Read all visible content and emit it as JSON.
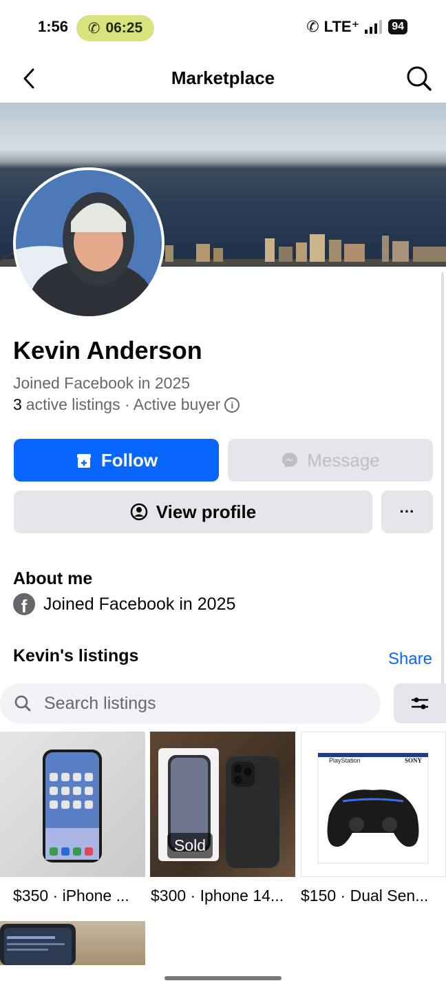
{
  "status": {
    "time": "1:56",
    "call_timer": "06:25",
    "network": "LTE⁺",
    "battery": "94"
  },
  "nav": {
    "title": "Marketplace"
  },
  "profile": {
    "name": "Kevin Anderson",
    "joined": "Joined Facebook in 2025",
    "active_count": "3",
    "active_text": "active listings · Active buyer"
  },
  "actions": {
    "follow": "Follow",
    "message": "Message",
    "view_profile": "View profile",
    "more": "···"
  },
  "about": {
    "title": "About me",
    "joined": "Joined Facebook in 2025"
  },
  "listings": {
    "title": "Kevin's listings",
    "share": "Share",
    "search_placeholder": "Search listings",
    "items": [
      {
        "caption": "$350 · iPhone ...",
        "badge": ""
      },
      {
        "caption": "$300 · Iphone 14...",
        "badge": "Sold"
      },
      {
        "caption": "$150 · Dual Sen...",
        "badge": ""
      }
    ],
    "tile3_brand_left": "PlayStation",
    "tile3_brand_right": "SONY"
  },
  "colors": {
    "accent": "#0866ff",
    "call_pill": "#d9e27d"
  }
}
